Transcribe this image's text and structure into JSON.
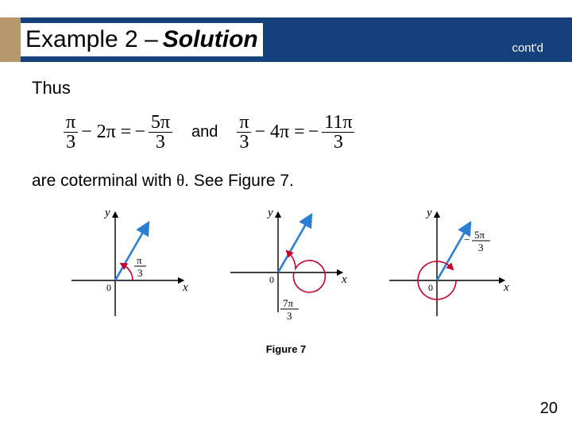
{
  "header": {
    "prefix": "Example 2 – ",
    "emph": "Solution",
    "contd": "cont'd"
  },
  "body": {
    "thus": "Thus",
    "and": "and",
    "coterminal_pre": "are coterminal with ",
    "theta": "θ",
    "coterminal_post": ". See Figure 7."
  },
  "eq1": {
    "n1": "π",
    "d1": "3",
    "op1": "− 2π =",
    "neg": "−",
    "n2": "5π",
    "d2": "3"
  },
  "eq2": {
    "n1": "π",
    "d1": "3",
    "op1": "− 4π =",
    "neg": "−",
    "n2": "11π",
    "d2": "3"
  },
  "figure": {
    "caption": "Figure 7",
    "x": "x",
    "y": "y",
    "origin": "0",
    "angles": [
      {
        "num": "π",
        "den": "3"
      },
      {
        "num": "7π",
        "den": "3"
      },
      {
        "num": "5π",
        "den": "3",
        "neg": "−"
      }
    ]
  },
  "pagenum": "20"
}
